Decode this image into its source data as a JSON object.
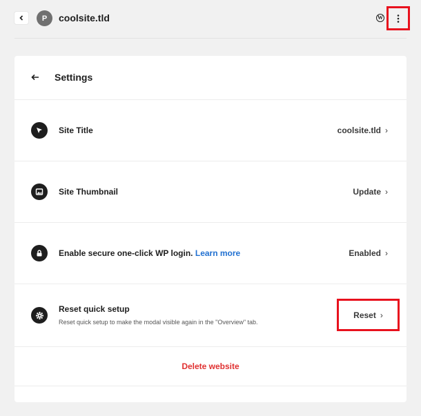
{
  "topbar": {
    "avatar_letter": "P",
    "site_name": "coolsite.tld",
    "wp_icon": "wordpress-icon",
    "more_icon": "vertical-dots-icon"
  },
  "settings": {
    "title": "Settings",
    "rows": [
      {
        "label": "Site Title",
        "value": "coolsite.tld",
        "icon": "cursor-arrow-icon"
      },
      {
        "label": "Site Thumbnail",
        "value": "Update",
        "icon": "image-icon"
      },
      {
        "label": "Enable secure one-click WP login.",
        "link": "Learn more",
        "value": "Enabled",
        "icon": "lock-icon"
      },
      {
        "label": "Reset quick setup",
        "desc": "Reset quick setup to make the modal visible again in the \"Overview\" tab.",
        "value": "Reset",
        "icon": "gear-icon"
      }
    ],
    "delete_label": "Delete website"
  },
  "colors": {
    "highlight": "#e8111d",
    "link": "#2271d1",
    "danger": "#e03131"
  }
}
